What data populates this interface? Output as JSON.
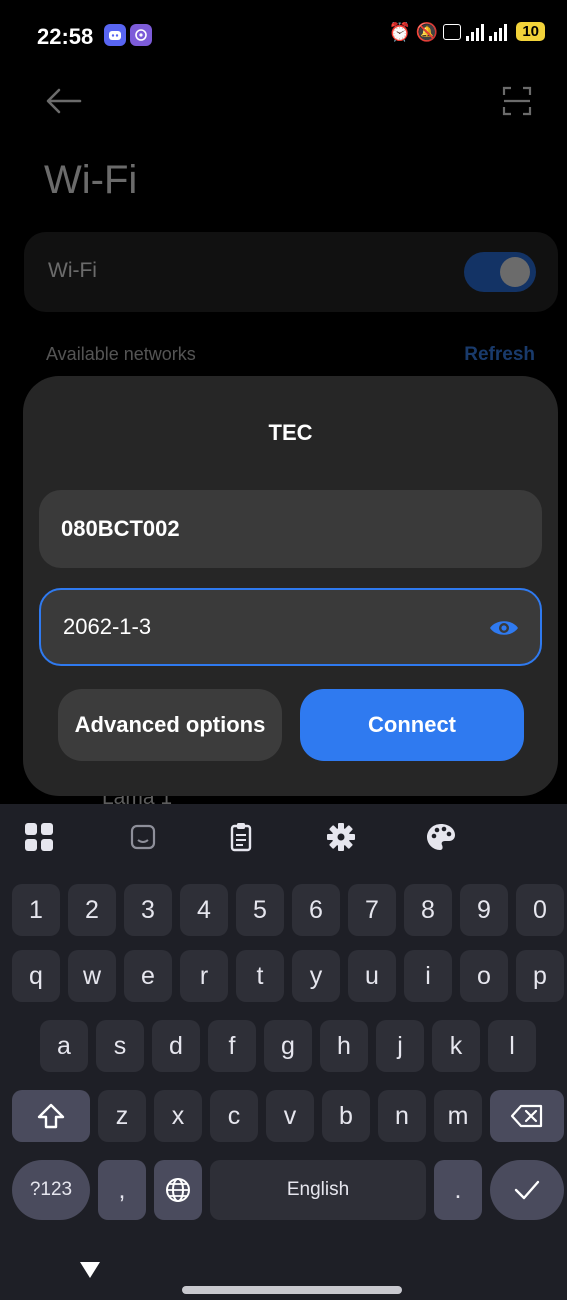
{
  "status_bar": {
    "time": "22:58",
    "battery": "10"
  },
  "header": {
    "title": "Wi-Fi"
  },
  "wifi_toggle": {
    "label": "Wi-Fi",
    "state": "on"
  },
  "networks": {
    "section_label": "Available networks",
    "refresh_label": "Refresh",
    "partially_visible_item": "Lama 1"
  },
  "dialog": {
    "title": "TEC",
    "username_value": "080BCT002",
    "password_value": "2062-1-3",
    "advanced_label": "Advanced options",
    "connect_label": "Connect"
  },
  "keyboard": {
    "toolbar_icons": [
      "apps-grid-icon",
      "sticker-icon",
      "clipboard-icon",
      "settings-gear-icon",
      "palette-icon"
    ],
    "row_numbers": [
      "1",
      "2",
      "3",
      "4",
      "5",
      "6",
      "7",
      "8",
      "9",
      "0"
    ],
    "row_q": [
      "q",
      "w",
      "e",
      "r",
      "t",
      "y",
      "u",
      "i",
      "o",
      "p"
    ],
    "row_a": [
      "a",
      "s",
      "d",
      "f",
      "g",
      "h",
      "j",
      "k",
      "l"
    ],
    "row_z": [
      "z",
      "x",
      "c",
      "v",
      "b",
      "n",
      "m"
    ],
    "symbols_label": "?123",
    "comma_label": ",",
    "space_label": "English",
    "period_label": "."
  },
  "colors": {
    "accent": "#2f7af0",
    "dialog_bg": "#262626",
    "keyboard_bg": "#1e1f26"
  }
}
